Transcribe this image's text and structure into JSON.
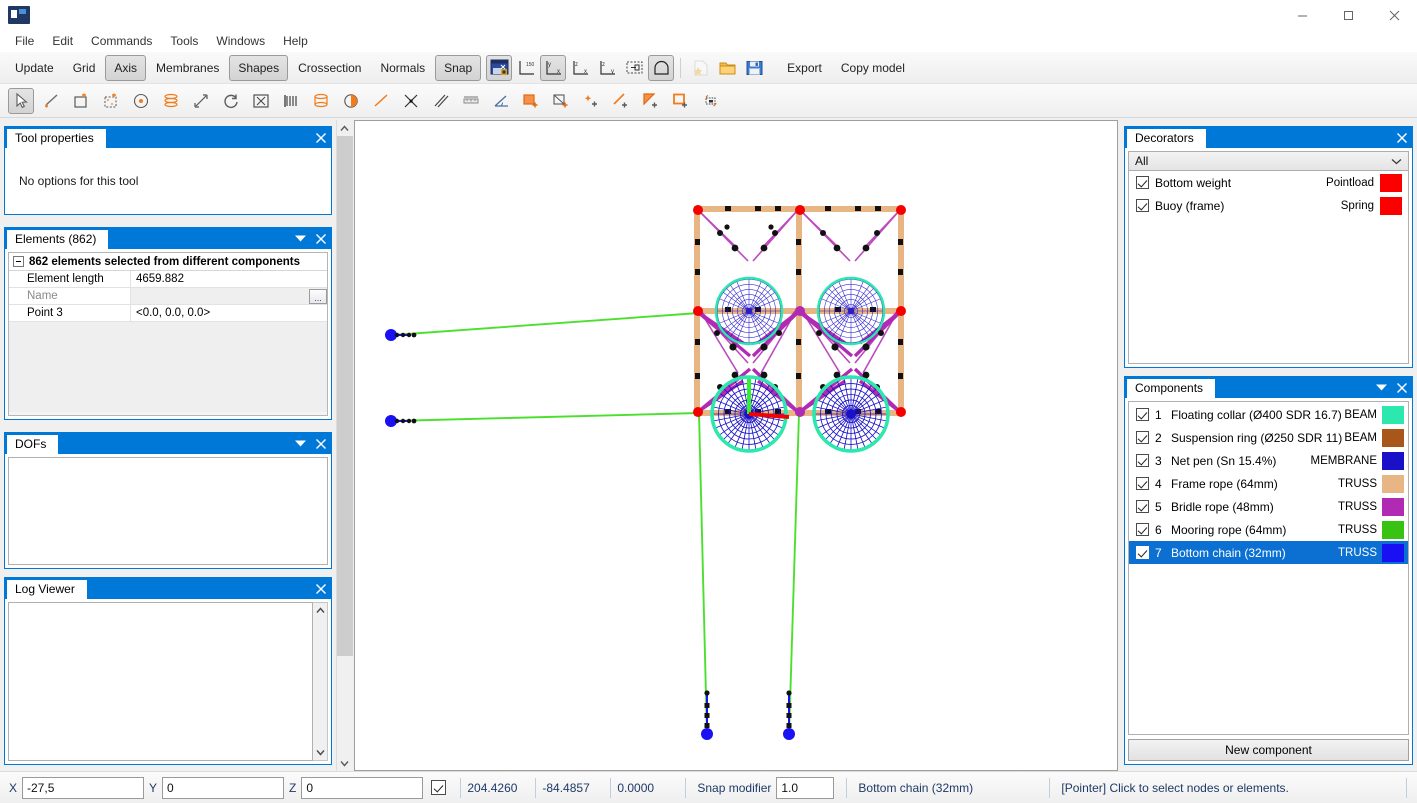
{
  "window": {
    "icon": "app-icon",
    "title": "",
    "minimize": "minimize-button",
    "maximize": "maximize-button",
    "close": "close-button"
  },
  "menubar": {
    "items": [
      "File",
      "Edit",
      "Commands",
      "Tools",
      "Windows",
      "Help"
    ]
  },
  "toolbar1": {
    "toggles": [
      {
        "label": "Update",
        "pressed": false
      },
      {
        "label": "Grid",
        "pressed": false
      },
      {
        "label": "Axis",
        "pressed": true
      },
      {
        "label": "Membranes",
        "pressed": false
      },
      {
        "label": "Shapes",
        "pressed": true
      },
      {
        "label": "Crossection",
        "pressed": false
      },
      {
        "label": "Normals",
        "pressed": false
      },
      {
        "label": "Snap",
        "pressed": true
      }
    ],
    "icons": [
      {
        "name": "lock-view-icon",
        "pressed": true
      },
      {
        "name": "iso-view-icon",
        "pressed": false
      },
      {
        "name": "front-view-icon",
        "pressed": true
      },
      {
        "name": "side-view-icon",
        "pressed": false
      },
      {
        "name": "top-view-icon",
        "pressed": false
      },
      {
        "name": "zoom-extents-icon",
        "pressed": false
      },
      {
        "name": "shape-view-icon",
        "pressed": true
      },
      {
        "name": "new-file-icon",
        "pressed": false
      },
      {
        "name": "open-folder-icon",
        "pressed": false
      },
      {
        "name": "save-icon",
        "pressed": false
      }
    ],
    "actions": [
      "Export",
      "Copy model"
    ]
  },
  "toolbar2": {
    "icons": [
      {
        "name": "pointer-select-icon",
        "pressed": true
      },
      {
        "name": "draw-line-icon",
        "pressed": false
      },
      {
        "name": "draw-rectangle-icon",
        "pressed": false
      },
      {
        "name": "mesh-rectangle-icon",
        "pressed": false
      },
      {
        "name": "circle-node-icon",
        "pressed": false
      },
      {
        "name": "cylinder-icon",
        "pressed": false
      },
      {
        "name": "scale-icon",
        "pressed": false
      },
      {
        "name": "rotate-icon",
        "pressed": false
      },
      {
        "name": "fit-selection-icon",
        "pressed": false
      },
      {
        "name": "array-copy-icon",
        "pressed": false
      },
      {
        "name": "extrude-icon",
        "pressed": false
      },
      {
        "name": "mirror-half-icon",
        "pressed": false
      },
      {
        "name": "diagonal-line-icon",
        "pressed": false
      },
      {
        "name": "intersection-icon",
        "pressed": false
      },
      {
        "name": "parallel-lines-icon",
        "pressed": false
      },
      {
        "name": "measure-distance-icon",
        "pressed": false
      },
      {
        "name": "measure-angle-icon",
        "pressed": false
      },
      {
        "name": "add-surface-icon",
        "pressed": false
      },
      {
        "name": "add-membrane-icon",
        "pressed": false
      },
      {
        "name": "add-point-icon",
        "pressed": false
      },
      {
        "name": "add-line-icon",
        "pressed": false
      },
      {
        "name": "add-triangle-icon",
        "pressed": false
      },
      {
        "name": "add-square-icon",
        "pressed": false
      },
      {
        "name": "label-tag-icon",
        "pressed": false
      }
    ]
  },
  "left": {
    "tool_properties": {
      "title": "Tool properties",
      "message": "No options for this tool"
    },
    "elements": {
      "title": "Elements (862)",
      "summary": "862 elements selected from different components",
      "rows": [
        {
          "key": "Element length",
          "value": "4659.882",
          "muted": false
        },
        {
          "key": "Name",
          "value": "",
          "muted": true
        },
        {
          "key": "Point 3",
          "value": "<0.0, 0.0, 0.0>",
          "muted": false
        }
      ],
      "ellipsis": "..."
    },
    "dofs": {
      "title": "DOFs"
    },
    "log_viewer": {
      "title": "Log Viewer"
    }
  },
  "right": {
    "decorators": {
      "title": "Decorators",
      "filter": "All",
      "items": [
        {
          "checked": true,
          "name": "Bottom weight",
          "type": "Pointload",
          "color": "#fc0000"
        },
        {
          "checked": true,
          "name": "Buoy (frame)",
          "type": "Spring",
          "color": "#fc0000"
        }
      ]
    },
    "components": {
      "title": "Components",
      "items": [
        {
          "index": "1",
          "checked": true,
          "name": "Floating collar (Ø400 SDR 16.7)",
          "type": "BEAM",
          "color": "#2ce8ae",
          "selected": false
        },
        {
          "index": "2",
          "checked": true,
          "name": "Suspension ring (Ø250 SDR 11)",
          "type": "BEAM",
          "color": "#a9561b",
          "selected": false
        },
        {
          "index": "3",
          "checked": true,
          "name": "Net pen (Sn 15.4%)",
          "type": "MEMBRANE",
          "color": "#1a10c8",
          "selected": false
        },
        {
          "index": "4",
          "checked": true,
          "name": "Frame rope (64mm)",
          "type": "TRUSS",
          "color": "#e8b584",
          "selected": false
        },
        {
          "index": "5",
          "checked": true,
          "name": "Bridle rope (48mm)",
          "type": "TRUSS",
          "color": "#b02ab4",
          "selected": false
        },
        {
          "index": "6",
          "checked": true,
          "name": "Mooring rope (64mm)",
          "type": "TRUSS",
          "color": "#38c211",
          "selected": false
        },
        {
          "index": "7",
          "checked": true,
          "name": "Bottom chain (32mm)",
          "type": "TRUSS",
          "color": "#1a10f4",
          "selected": true
        }
      ],
      "new_button": "New component"
    }
  },
  "statusbar": {
    "x_label": "X",
    "x_value": "-27,5",
    "y_label": "Y",
    "y_value": "0",
    "z_label": "Z",
    "z_value": "0",
    "checkbox_checked": true,
    "readouts": [
      "204.4260",
      "-84.4857",
      "0.0000"
    ],
    "snap_label": "Snap modifier",
    "snap_value": "1.0",
    "active_component": "Bottom chain (32mm)",
    "hint": "[Pointer] Click to select nodes or elements."
  },
  "scene": {
    "description": "Aquaculture net pen FEA model: 2x2 cage array with floating collars, net pens, frame ropes, bridle ropes, mooring lines and bottom chains",
    "colors": {
      "frame_rope": "#e8b584",
      "bridle_rope": "#b02ab4",
      "net_pen": "#1a10c8",
      "collar": "#2ce8ae",
      "mooring_rope": "#4ce02e",
      "bottom_chain": "#1a10f4",
      "node_red": "#f40000",
      "axis_x": "#f40000",
      "axis_y": "#2ef42e"
    }
  }
}
